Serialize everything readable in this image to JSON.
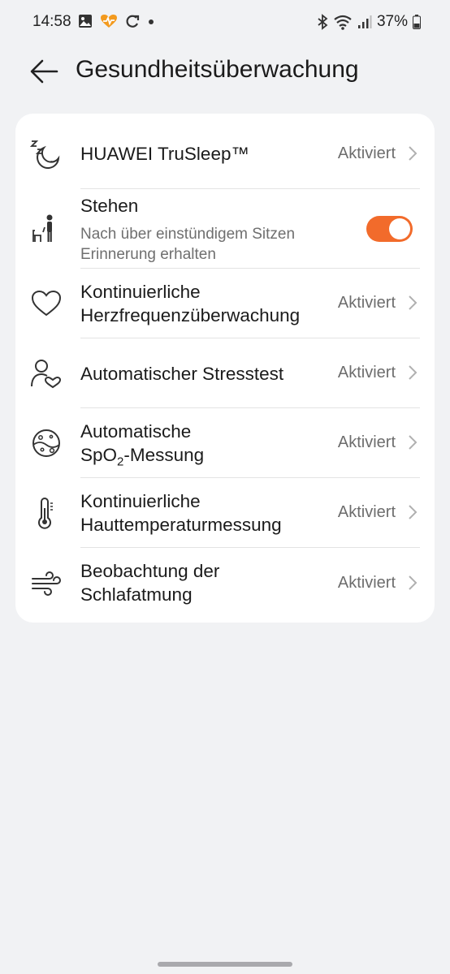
{
  "status_bar": {
    "time": "14:58",
    "battery": "37%",
    "left_icons": [
      "gallery-icon",
      "health-app-icon",
      "sync-icon",
      "dot-icon"
    ],
    "right_icons": [
      "bluetooth-icon",
      "wifi-icon",
      "signal-icon",
      "battery-icon"
    ]
  },
  "header": {
    "title": "Gesundheitsüberwachung"
  },
  "items": [
    {
      "icon": "sleep-icon",
      "label": "HUAWEI TruSleep™",
      "status": "Aktiviert"
    },
    {
      "icon": "standing-icon",
      "label": "Stehen",
      "sub_line1": "Nach über einstündigem Sitzen",
      "sub_line2": "Erinnerung erhalten",
      "toggle_on": true
    },
    {
      "icon": "heart-icon",
      "label_line1": "Kontinuierliche",
      "label_line2": "Herzfrequenzüberwachung",
      "status": "Aktiviert"
    },
    {
      "icon": "stress-icon",
      "label": "Automatischer Stresstest",
      "status": "Aktiviert"
    },
    {
      "icon": "spo2-icon",
      "label_line1": "Automatische",
      "label_line2_a": "SpO",
      "label_line2_sub": "2",
      "label_line2_b": "-Messung",
      "status": "Aktiviert"
    },
    {
      "icon": "thermometer-icon",
      "label_line1": "Kontinuierliche",
      "label_line2": "Hauttemperaturmessung",
      "status": "Aktiviert"
    },
    {
      "icon": "breathing-icon",
      "label_line1": "Beobachtung der",
      "label_line2": "Schlafatmung",
      "status": "Aktiviert"
    }
  ],
  "colors": {
    "background": "#f1f2f4",
    "card": "#ffffff",
    "accent_toggle": "#f26b2b"
  }
}
